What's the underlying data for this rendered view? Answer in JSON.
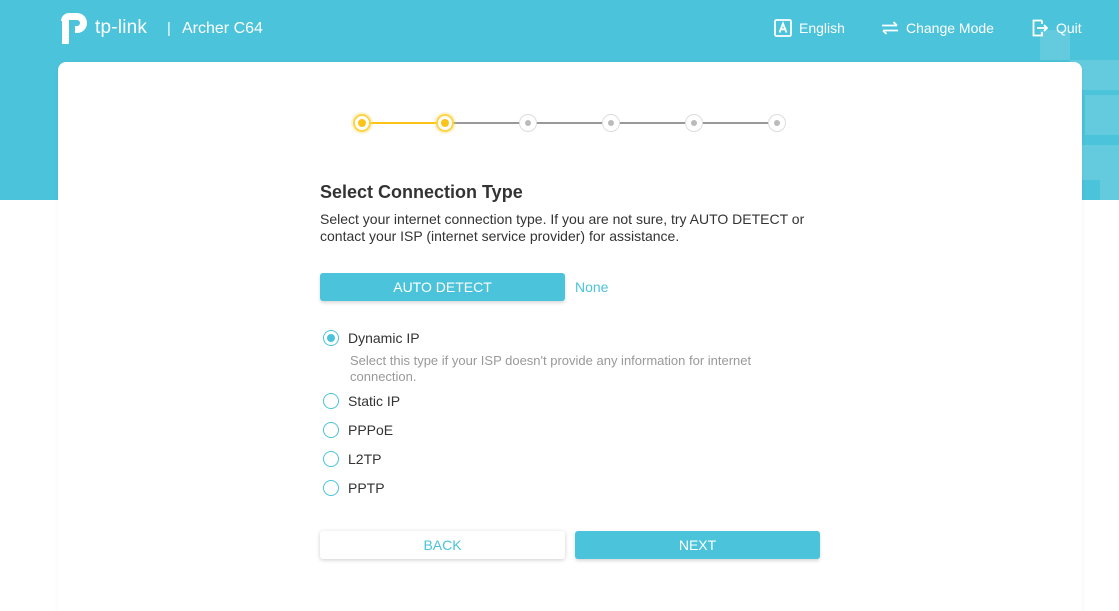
{
  "header": {
    "brand": "tp-link",
    "separator": "|",
    "model": "Archer C64",
    "nav": {
      "language": "English",
      "change_mode": "Change Mode",
      "quit": "Quit"
    }
  },
  "wizard": {
    "steps_total": 6,
    "steps_active": 2,
    "title": "Select Connection Type",
    "description": "Select your internet connection type. If you are not sure, try AUTO DETECT or contact your ISP (internet service provider) for assistance.",
    "auto_detect_label": "AUTO DETECT",
    "detect_result": "None",
    "options": [
      {
        "label": "Dynamic IP",
        "checked": true
      },
      {
        "label": "Static IP",
        "checked": false
      },
      {
        "label": "PPPoE",
        "checked": false
      },
      {
        "label": "L2TP",
        "checked": false
      },
      {
        "label": "PPTP",
        "checked": false
      }
    ],
    "selected_help": "Select this type if your ISP doesn't provide any information for internet connection.",
    "back_label": "BACK",
    "next_label": "NEXT"
  },
  "colors": {
    "accent": "#4bc3da",
    "step_active": "#fcc419",
    "step_inactive": "#bbbbbb"
  }
}
